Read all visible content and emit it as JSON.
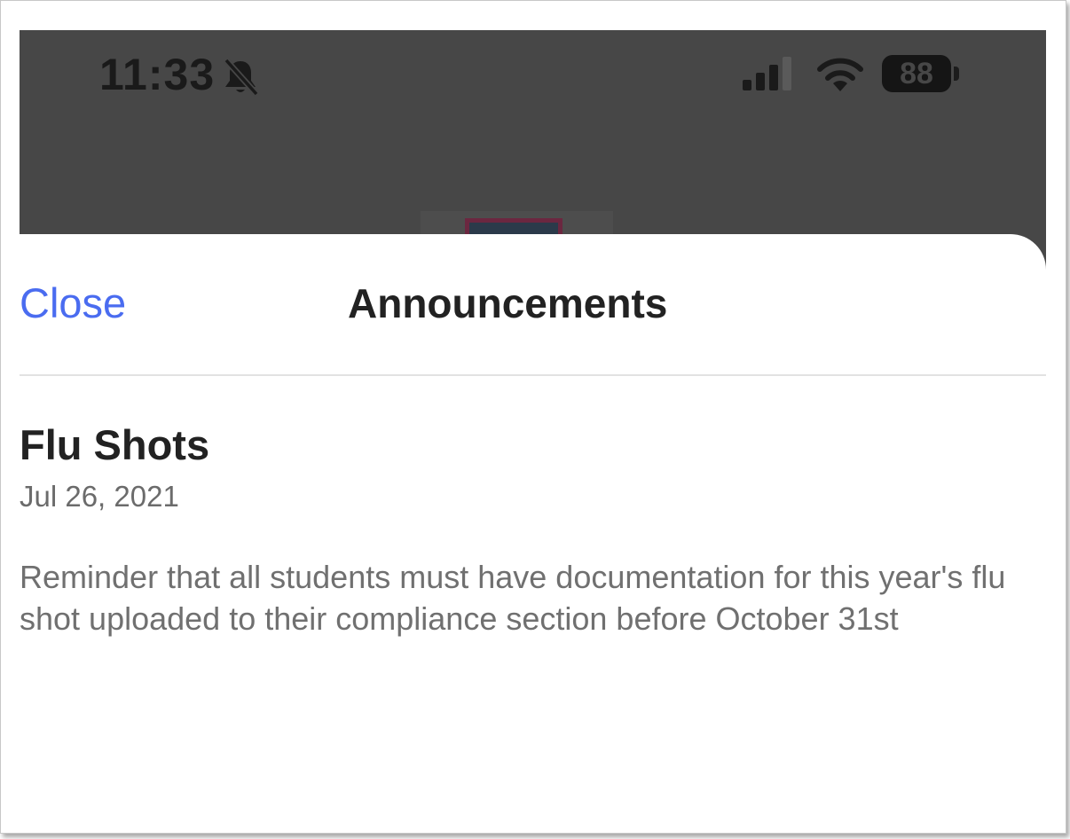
{
  "status_bar": {
    "time": "11:33",
    "battery": "88",
    "icons": [
      "bell-slash-icon",
      "cellular-signal-icon",
      "wifi-icon",
      "battery-icon"
    ]
  },
  "sheet": {
    "close_label": "Close",
    "title": "Announcements"
  },
  "announcement": {
    "title": "Flu Shots",
    "date": "Jul 26, 2021",
    "body": "Reminder that all students must have documentation for this year's flu shot uploaded to their compliance section before October 31st"
  },
  "colors": {
    "accent": "#4a6cf0",
    "dimmed_background": "#474747"
  }
}
